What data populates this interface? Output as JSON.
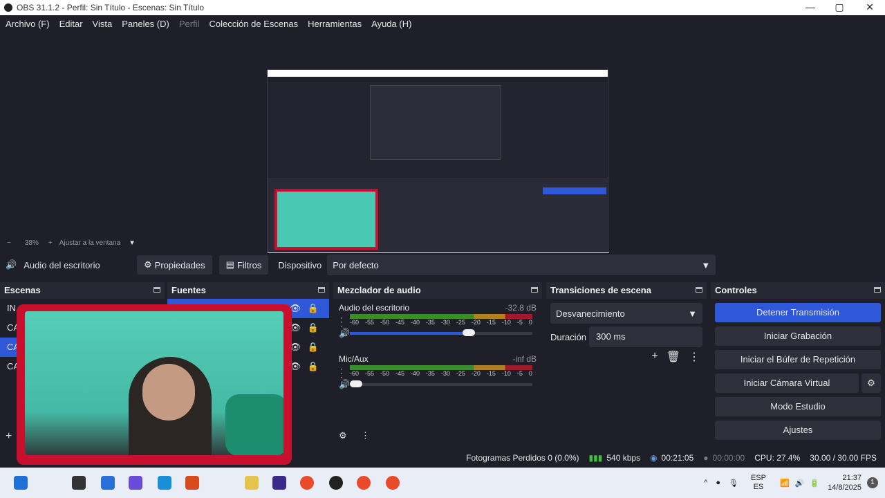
{
  "window": {
    "title": "OBS 31.1.2 - Perfil: Sin Título - Escenas: Sin Título"
  },
  "menu": [
    {
      "label": "Archivo (F)",
      "enabled": true
    },
    {
      "label": "Editar",
      "enabled": true
    },
    {
      "label": "Vista",
      "enabled": true
    },
    {
      "label": "Paneles (D)",
      "enabled": true
    },
    {
      "label": "Perfil",
      "enabled": false
    },
    {
      "label": "Colección de Escenas",
      "enabled": true
    },
    {
      "label": "Herramientas",
      "enabled": true
    },
    {
      "label": "Ayuda (H)",
      "enabled": true
    }
  ],
  "zoom": {
    "minus": "−",
    "value": "38%",
    "plus": "+",
    "fit": "Ajustar a la ventana"
  },
  "context": {
    "source_name": "Audio del escritorio",
    "properties": "Propiedades",
    "filters": "Filtros",
    "device_label": "Dispositivo",
    "device_value": "Por defecto"
  },
  "docks": {
    "scenes": {
      "title": "Escenas",
      "items": [
        "IN",
        "CA",
        "CA",
        "CA"
      ],
      "active_index": 2
    },
    "sources": {
      "title": "Fuentes"
    },
    "mixer": {
      "title": "Mezclador de audio",
      "channels": [
        {
          "name": "Audio del escritorio",
          "db": "-32.8 dB",
          "volume": 0.65
        },
        {
          "name": "Mic/Aux",
          "db": "-inf dB",
          "volume": 0.0
        }
      ],
      "ticks": [
        "-60",
        "-55",
        "-50",
        "-45",
        "-40",
        "-35",
        "-30",
        "-25",
        "-20",
        "-15",
        "-10",
        "-5",
        "0"
      ]
    },
    "transitions": {
      "title": "Transiciones de escena",
      "selected": "Desvanecimiento",
      "duration_label": "Duración",
      "duration_value": "300 ms"
    },
    "controls": {
      "title": "Controles",
      "stop_stream": "Detener Transmisión",
      "start_recording": "Iniciar Grabación",
      "replay_buffer": "Iniciar el Búfer de Repetición",
      "virtual_camera": "Iniciar Cámara Virtual",
      "studio_mode": "Modo Estudio",
      "settings": "Ajustes"
    }
  },
  "status": {
    "dropped_frames": "Fotogramas Perdidos 0 (0.0%)",
    "bitrate": "540 kbps",
    "stream_time": "00:21:05",
    "record_time": "00:00:00",
    "cpu": "CPU: 27.4%",
    "fps": "30.00 / 30.00 FPS"
  },
  "taskbar": {
    "lang_top": "ESP",
    "lang_bottom": "ES",
    "time": "21:37",
    "date": "14/8/2025",
    "notifications": "1"
  },
  "colors": {
    "accent": "#2f58d8",
    "bg": "#1e1f29",
    "dock": "#272834",
    "overlay_red": "#c8102e"
  }
}
